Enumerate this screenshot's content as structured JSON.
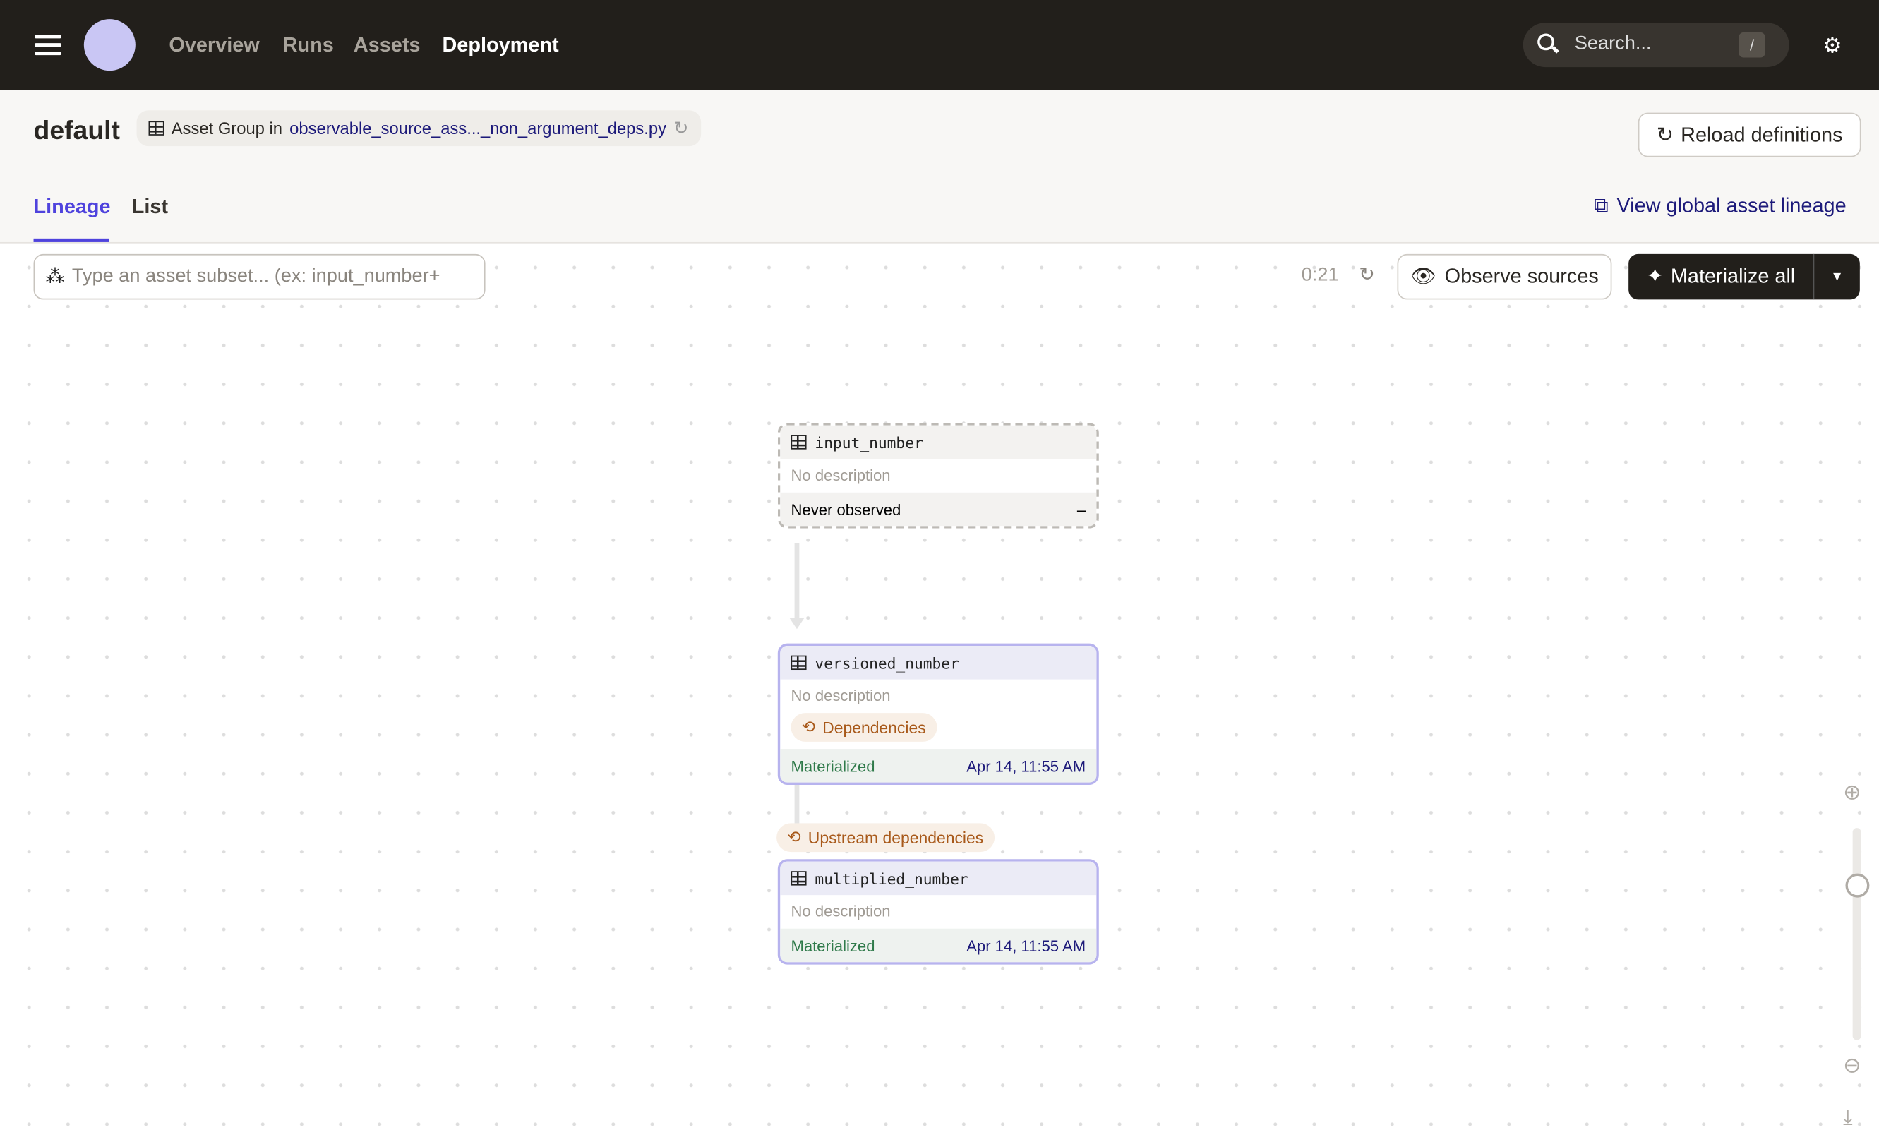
{
  "topbar": {
    "nav": [
      "Overview",
      "Runs",
      "Assets",
      "Deployment"
    ],
    "active_nav": "Deployment",
    "search_placeholder": "Search...",
    "search_shortcut": "/"
  },
  "header": {
    "title": "default",
    "group_prefix": "Asset Group in",
    "group_location": "observable_source_ass..._non_argument_deps.py",
    "reload_label": "Reload definitions",
    "tabs": [
      "Lineage",
      "List"
    ],
    "active_tab": "Lineage",
    "global_lineage_label": "View global asset lineage"
  },
  "toolbar": {
    "filter_placeholder": "Type an asset subset... (ex: input_number+",
    "timer": "0:21",
    "observe_label": "Observe sources",
    "materialize_label": "Materialize all"
  },
  "graph": {
    "nodes": [
      {
        "name": "input_number",
        "description": "No description",
        "status": "Never observed",
        "status_value": "–"
      },
      {
        "name": "versioned_number",
        "description": "No description",
        "badge": "Dependencies",
        "status": "Materialized",
        "timestamp": "Apr 14, 11:55 AM"
      },
      {
        "name": "multiplied_number",
        "description": "No description",
        "status": "Materialized",
        "timestamp": "Apr 14, 11:55 AM"
      }
    ],
    "edge_badge": "Upstream dependencies"
  },
  "colors": {
    "accent": "#4f43dd",
    "topbar": "#221f1b",
    "materialized": "#2f7a4a",
    "warning": "#a8591a"
  }
}
